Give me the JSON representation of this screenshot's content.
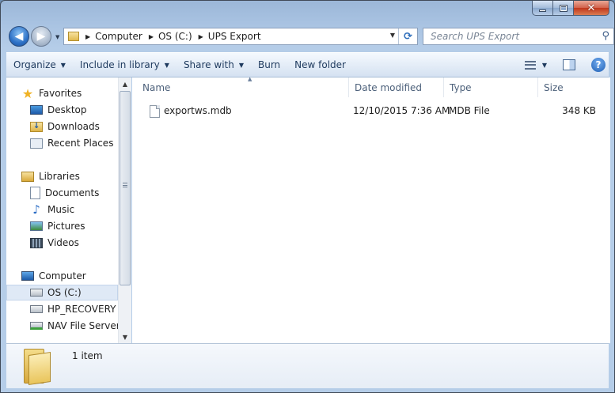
{
  "window": {
    "title": "UPS Export"
  },
  "caption": {
    "minimize": "–",
    "maximize": "□",
    "close": "✕"
  },
  "nav": {
    "back": "◀",
    "forward": "▶",
    "recent": "▼"
  },
  "address": {
    "crumbs": [
      "Computer",
      "OS (C:)",
      "UPS Export"
    ],
    "arrow": "▶",
    "dropdown": "▼",
    "refresh": "⟳"
  },
  "search": {
    "placeholder": "Search UPS Export",
    "icon": "⚲"
  },
  "toolbar": {
    "organize": "Organize",
    "include_in_library": "Include in library",
    "share_with": "Share with",
    "burn": "Burn",
    "new_folder": "New folder",
    "caret": "▼",
    "help": "?"
  },
  "sidebar": {
    "favorites": "Favorites",
    "desktop": "Desktop",
    "downloads": "Downloads",
    "recent_places": "Recent Places",
    "libraries": "Libraries",
    "documents": "Documents",
    "music": "Music",
    "pictures": "Pictures",
    "videos": "Videos",
    "computer": "Computer",
    "os_c": "OS (C:)",
    "hp_recovery": "HP_RECOVERY (D",
    "nav_file_server": "NAV File Server (I",
    "scroll_up": "▲",
    "scroll_down": "▼"
  },
  "columns": {
    "name": "Name",
    "date_modified": "Date modified",
    "type": "Type",
    "size": "Size",
    "sort_indicator": "▲"
  },
  "files": [
    {
      "name": "exportws.mdb",
      "date_modified": "12/10/2015 7:36 AM",
      "type": "MDB File",
      "size": "348 KB"
    }
  ],
  "details": {
    "item_count": "1 item"
  },
  "colors": {
    "frame": "#b5cde8",
    "toolbar_text": "#1e3a5e",
    "selected_nav": "#dfe9f6",
    "close_button": "#c1371c"
  }
}
